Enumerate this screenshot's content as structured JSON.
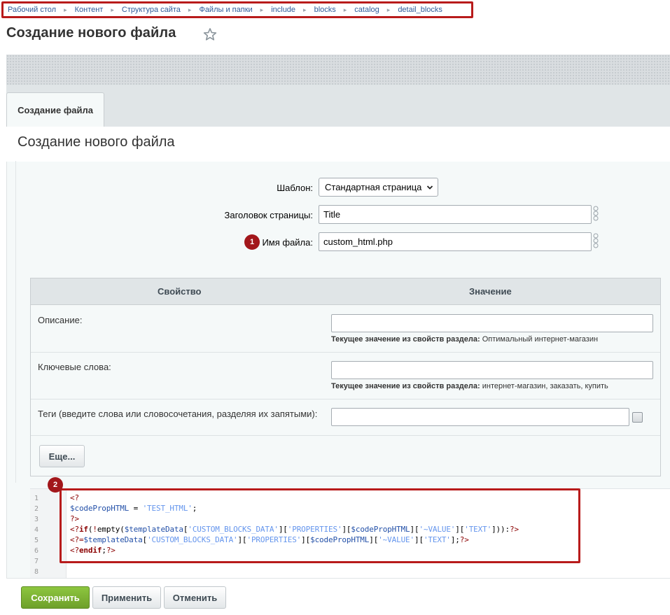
{
  "breadcrumb": [
    "Рабочий стол",
    "Контент",
    "Структура сайта",
    "Файлы и папки",
    "include",
    "blocks",
    "catalog",
    "detail_blocks"
  ],
  "page": {
    "title": "Создание нового файла"
  },
  "tabs": [
    {
      "label": "Создание файла"
    }
  ],
  "section": {
    "title": "Создание нового файла"
  },
  "form": {
    "template_label": "Шаблон:",
    "template_value": "Стандартная страница",
    "page_title_label": "Заголовок страницы:",
    "page_title_value": "Title",
    "filename_label": "Имя файла:",
    "filename_value": "custom_html.php",
    "filename_badge": "1"
  },
  "properties": {
    "col_property": "Свойство",
    "col_value": "Значение",
    "current_prefix": "Текущее значение из свойств раздела:",
    "rows": [
      {
        "label": "Описание:",
        "value": "",
        "current": "Оптимальный интернет-магазин"
      },
      {
        "label": "Ключевые слова:",
        "value": "",
        "current": "интернет-магазин, заказать, купить"
      },
      {
        "label": "Теги (введите слова или словосочетания, разделяя их запятыми):",
        "value": ""
      }
    ],
    "more_label": "Еще..."
  },
  "editor": {
    "badge": "2",
    "line_numbers": [
      "1",
      "2",
      "3",
      "4",
      "5",
      "6",
      "7",
      "8"
    ]
  },
  "buttons": {
    "save": "Сохранить",
    "apply": "Применить",
    "cancel": "Отменить"
  },
  "colors": {
    "highlight": "#b81b1b",
    "badge": "#a2171b",
    "save_button": "#7cb333",
    "link": "#2e5b9a"
  },
  "icons": [
    "star-icon",
    "chevron-right-icon",
    "chevron-down-icon",
    "hint-icon"
  ]
}
